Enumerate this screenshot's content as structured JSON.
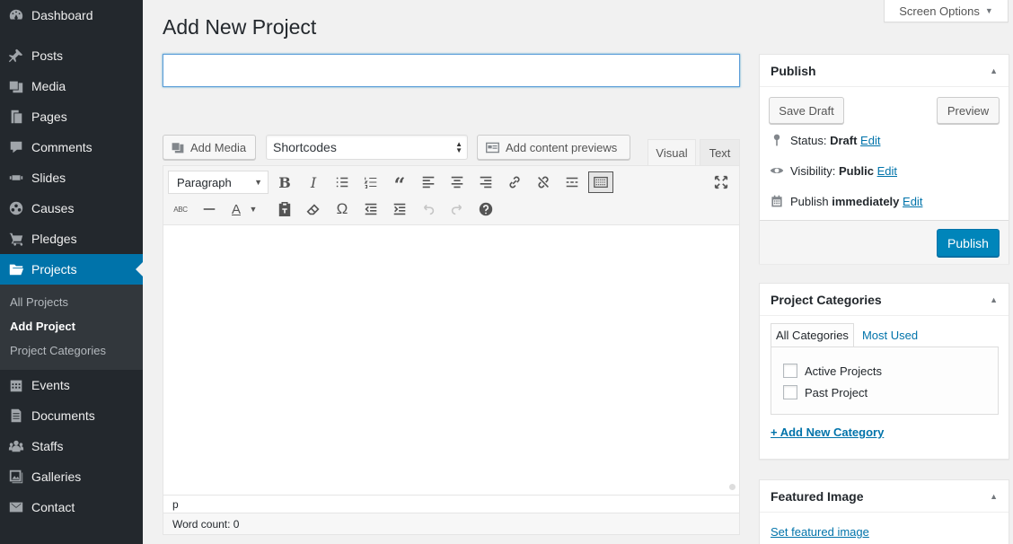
{
  "sidebar": {
    "items": [
      {
        "label": "Dashboard",
        "icon": "dashboard-icon"
      },
      {
        "label": "Posts",
        "icon": "pin-icon"
      },
      {
        "label": "Media",
        "icon": "media-icon"
      },
      {
        "label": "Pages",
        "icon": "pages-icon"
      },
      {
        "label": "Comments",
        "icon": "comment-icon"
      },
      {
        "label": "Slides",
        "icon": "slides-icon"
      },
      {
        "label": "Causes",
        "icon": "causes-icon"
      },
      {
        "label": "Pledges",
        "icon": "cart-icon"
      },
      {
        "label": "Projects",
        "icon": "folder-icon"
      },
      {
        "label": "Events",
        "icon": "calendar-icon"
      },
      {
        "label": "Documents",
        "icon": "document-icon"
      },
      {
        "label": "Staffs",
        "icon": "groups-icon"
      },
      {
        "label": "Galleries",
        "icon": "gallery-icon"
      },
      {
        "label": "Contact",
        "icon": "email-icon"
      }
    ],
    "submenu": [
      "All Projects",
      "Add Project",
      "Project Categories"
    ]
  },
  "screen_options": "Screen Options",
  "page_title": "Add New Project",
  "title_input": {
    "value": "",
    "placeholder": ""
  },
  "media_buttons": {
    "add_media": "Add Media",
    "shortcodes": "Shortcodes",
    "add_content_previews": "Add content previews"
  },
  "editor": {
    "tabs": {
      "visual": "Visual",
      "text": "Text"
    },
    "format": "Paragraph",
    "path": "p",
    "word_count": "Word count: 0"
  },
  "publish": {
    "title": "Publish",
    "save_draft": "Save Draft",
    "preview": "Preview",
    "status_label": "Status: ",
    "status_value": "Draft",
    "visibility_label": "Visibility: ",
    "visibility_value": "Public",
    "publish_label": "Publish ",
    "publish_value": "immediately",
    "edit": "Edit",
    "publish_button": "Publish"
  },
  "categories": {
    "title": "Project Categories",
    "tab_all": "All Categories",
    "tab_most_used": "Most Used",
    "items": [
      "Active Projects",
      "Past Project"
    ],
    "add_new": "+ Add New Category"
  },
  "featured": {
    "title": "Featured Image",
    "set_link": "Set featured image"
  },
  "colors": {
    "accent": "#0073aa",
    "sidebar": "#23282d",
    "publish_button": "#0085ba"
  }
}
